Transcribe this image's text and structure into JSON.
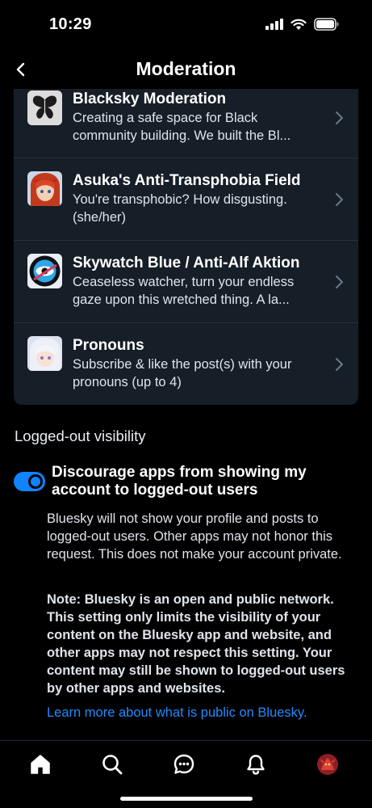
{
  "status_bar": {
    "time": "10:29",
    "icons": [
      "signal-icon",
      "wifi-icon",
      "battery-icon"
    ]
  },
  "header": {
    "title": "Moderation",
    "back_icon": "chevron-left-icon"
  },
  "labelers": [
    {
      "name": "Blacksky Moderation",
      "description": "Creating a safe space for Black community building. We built the Bl...",
      "avatar": "butterfly-avatar"
    },
    {
      "name": "Asuka's Anti-Transphobia Field",
      "description": "You're transphobic? How disgusting. (she/her)",
      "avatar": "anime-girl-red-hair-avatar"
    },
    {
      "name": "Skywatch Blue / Anti-Alf Aktion",
      "description": "Ceaseless watcher, turn your endless gaze upon this wretched thing. A la...",
      "avatar": "eye-badge-avatar"
    },
    {
      "name": "Pronouns",
      "description": "Subscribe & like the post(s) with your pronouns (up to 4)",
      "avatar": "anime-girl-white-hair-avatar"
    }
  ],
  "visibility": {
    "section_title": "Logged-out visibility",
    "toggle_label": "Discourage apps from showing my account to logged-out users",
    "toggle_on": true,
    "paragraph_1": "Bluesky will not show your profile and posts to logged-out users. Other apps may not honor this request. This does not make your account private.",
    "paragraph_2": "Note: Bluesky is an open and public network. This setting only limits the visibility of your content on the Bluesky app and website, and other apps may not respect this setting. Your content may still be shown to logged-out users by other apps and websites.",
    "link": "Learn more about what is public on Bluesky."
  },
  "tab_bar": {
    "tabs": [
      "home-icon",
      "search-icon",
      "chat-icon",
      "notifications-icon",
      "profile-avatar"
    ]
  },
  "colors": {
    "background": "#000000",
    "card": "#161e27",
    "accent": "#1083fe",
    "link": "#208bfe",
    "text_secondary": "#dfe4ea"
  }
}
